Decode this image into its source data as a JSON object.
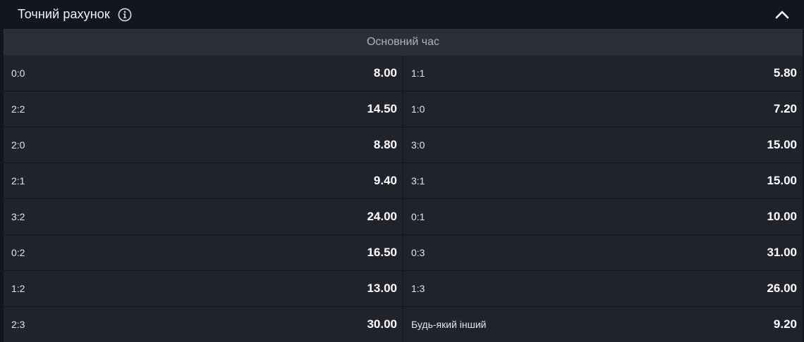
{
  "header": {
    "title": "Точний рахунок",
    "info_icon": "info-icon",
    "collapse_icon": "chevron-up-icon"
  },
  "section": {
    "title": "Основний час"
  },
  "rows": [
    [
      {
        "label": "0:0",
        "odds": "8.00"
      },
      {
        "label": "1:1",
        "odds": "5.80"
      }
    ],
    [
      {
        "label": "2:2",
        "odds": "14.50"
      },
      {
        "label": "1:0",
        "odds": "7.20"
      }
    ],
    [
      {
        "label": "2:0",
        "odds": "8.80"
      },
      {
        "label": "3:0",
        "odds": "15.00"
      }
    ],
    [
      {
        "label": "2:1",
        "odds": "9.40"
      },
      {
        "label": "3:1",
        "odds": "15.00"
      }
    ],
    [
      {
        "label": "3:2",
        "odds": "24.00"
      },
      {
        "label": "0:1",
        "odds": "10.00"
      }
    ],
    [
      {
        "label": "0:2",
        "odds": "16.50"
      },
      {
        "label": "0:3",
        "odds": "31.00"
      }
    ],
    [
      {
        "label": "1:2",
        "odds": "13.00"
      },
      {
        "label": "1:3",
        "odds": "26.00"
      }
    ],
    [
      {
        "label": "2:3",
        "odds": "30.00"
      },
      {
        "label": "Будь-який інший",
        "odds": "9.20"
      }
    ]
  ]
}
